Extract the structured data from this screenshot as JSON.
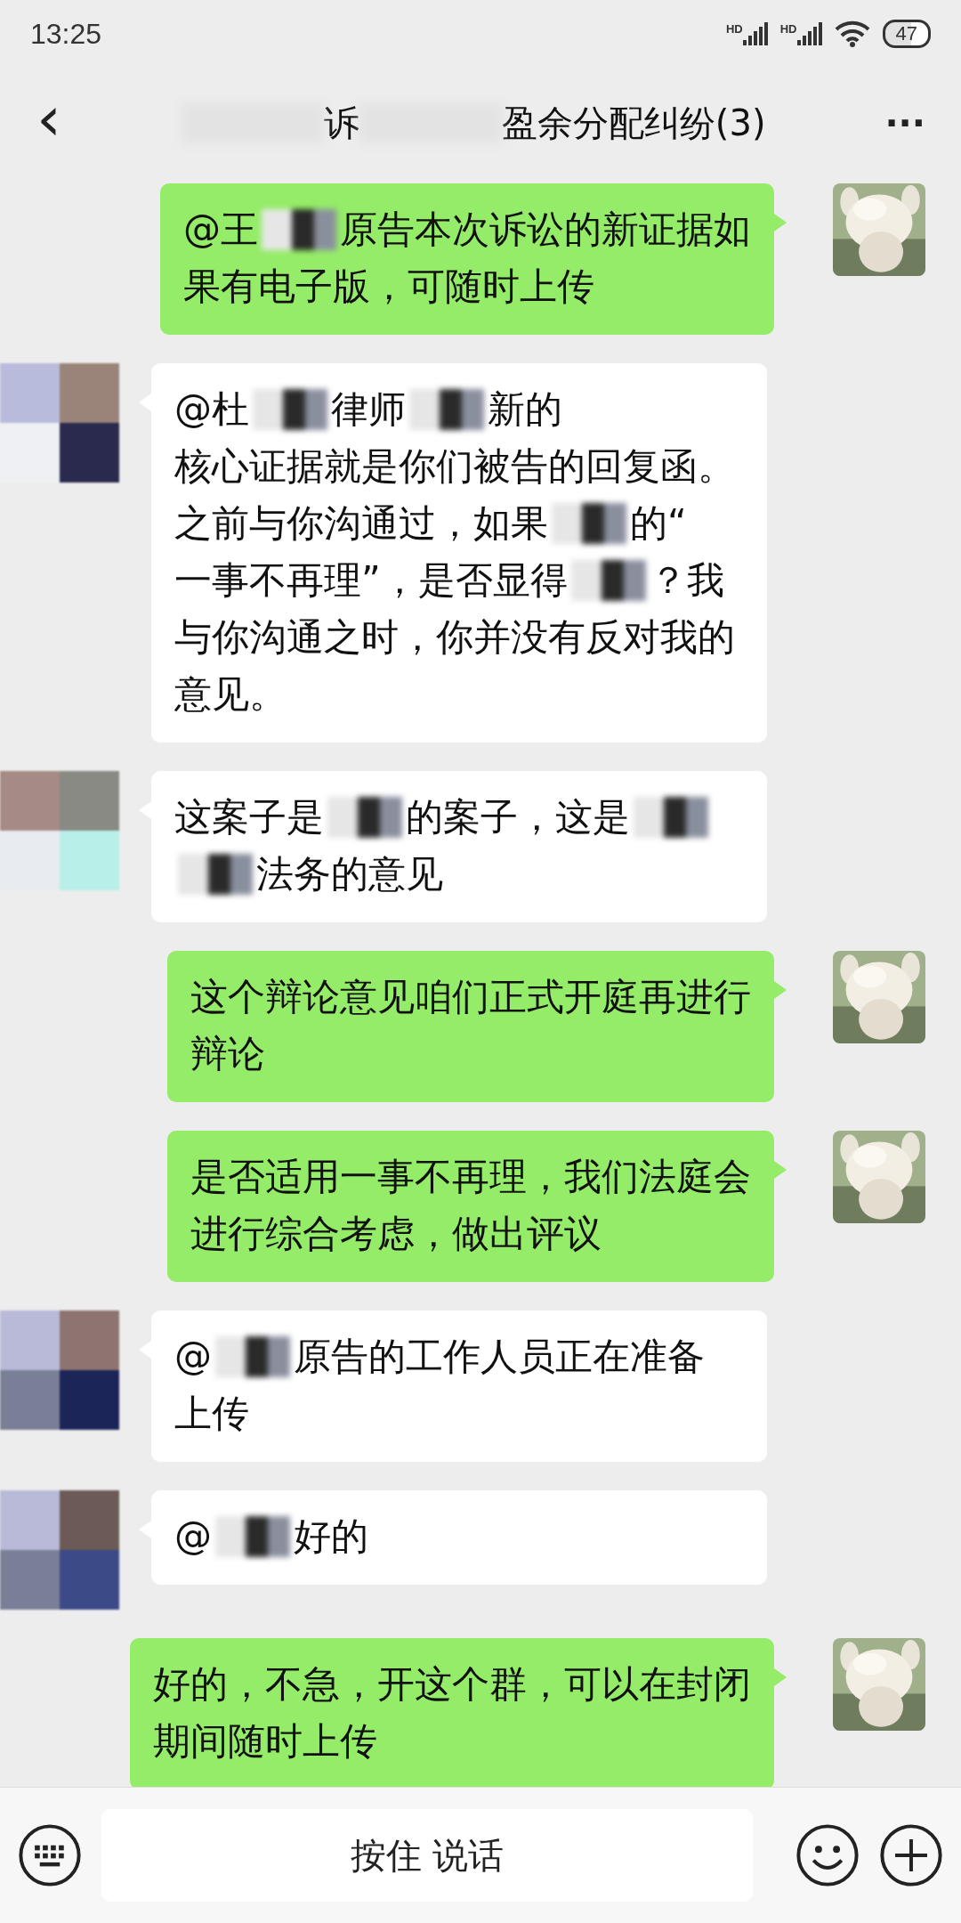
{
  "status_bar": {
    "time": "13:25",
    "network_labels": [
      "HD",
      "HD"
    ],
    "battery": "47"
  },
  "header": {
    "title_segments": [
      {
        "kind": "blur"
      },
      {
        "kind": "text",
        "text": "诉"
      },
      {
        "kind": "blur"
      },
      {
        "kind": "text",
        "text": "盈余分配纠纷(3)"
      }
    ],
    "back": "‹",
    "more": "···"
  },
  "messages": [
    {
      "kind": "sent",
      "lines": [
        [
          {
            "kind": "text",
            "text": "@王"
          },
          {
            "kind": "blur"
          },
          {
            "kind": "text",
            "text": "原告本次诉讼的新证据如"
          }
        ],
        [
          {
            "kind": "text",
            "text": "果有电子版，可随时上传"
          }
        ]
      ]
    },
    {
      "kind": "received",
      "lines": [
        [
          {
            "kind": "text",
            "text": "@杜"
          },
          {
            "kind": "blur"
          },
          {
            "kind": "text",
            "text": "律师"
          },
          {
            "kind": "blur"
          },
          {
            "kind": "text",
            "text": "新的"
          }
        ],
        [
          {
            "kind": "text",
            "text": "核心证据就是你们被告的回复函。"
          }
        ],
        [
          {
            "kind": "text",
            "text": "之前与你沟通过，如果"
          },
          {
            "kind": "blur"
          },
          {
            "kind": "text",
            "text": "的“"
          }
        ],
        [
          {
            "kind": "text",
            "text": "一事不再理”，是否显得"
          },
          {
            "kind": "blur"
          },
          {
            "kind": "text",
            "text": "？我"
          }
        ],
        [
          {
            "kind": "text",
            "text": "与你沟通之时，你并没有反对我的"
          }
        ],
        [
          {
            "kind": "text",
            "text": "意见。"
          }
        ]
      ]
    },
    {
      "kind": "received",
      "lines": [
        [
          {
            "kind": "text",
            "text": "这案子是"
          },
          {
            "kind": "blur"
          },
          {
            "kind": "text",
            "text": "的案子，这是"
          },
          {
            "kind": "blur"
          }
        ],
        [
          {
            "kind": "blur"
          },
          {
            "kind": "text",
            "text": "法务的意见"
          }
        ]
      ]
    },
    {
      "kind": "sent",
      "lines": [
        [
          {
            "kind": "text",
            "text": "这个辩论意见咱们正式开庭再进行"
          }
        ],
        [
          {
            "kind": "text",
            "text": "辩论"
          }
        ]
      ]
    },
    {
      "kind": "sent",
      "lines": [
        [
          {
            "kind": "text",
            "text": "是否适用一事不再理，我们法庭会"
          }
        ],
        [
          {
            "kind": "text",
            "text": "进行综合考虑，做出评议"
          }
        ]
      ]
    },
    {
      "kind": "received",
      "lines": [
        [
          {
            "kind": "text",
            "text": "@"
          },
          {
            "kind": "blur"
          },
          {
            "kind": "text",
            "text": "原告的工作人员正在准备"
          }
        ],
        [
          {
            "kind": "text",
            "text": "上传"
          }
        ]
      ]
    },
    {
      "kind": "received",
      "lines": [
        [
          {
            "kind": "text",
            "text": "@"
          },
          {
            "kind": "blur"
          },
          {
            "kind": "text",
            "text": "好的"
          }
        ]
      ]
    },
    {
      "kind": "sent",
      "lines": [
        [
          {
            "kind": "text",
            "text": "好的，不急，开这个群，可以在封闭"
          }
        ],
        [
          {
            "kind": "text",
            "text": "期间随时上传"
          }
        ]
      ]
    }
  ],
  "input_bar": {
    "hold_to_talk": "按住 说话"
  }
}
